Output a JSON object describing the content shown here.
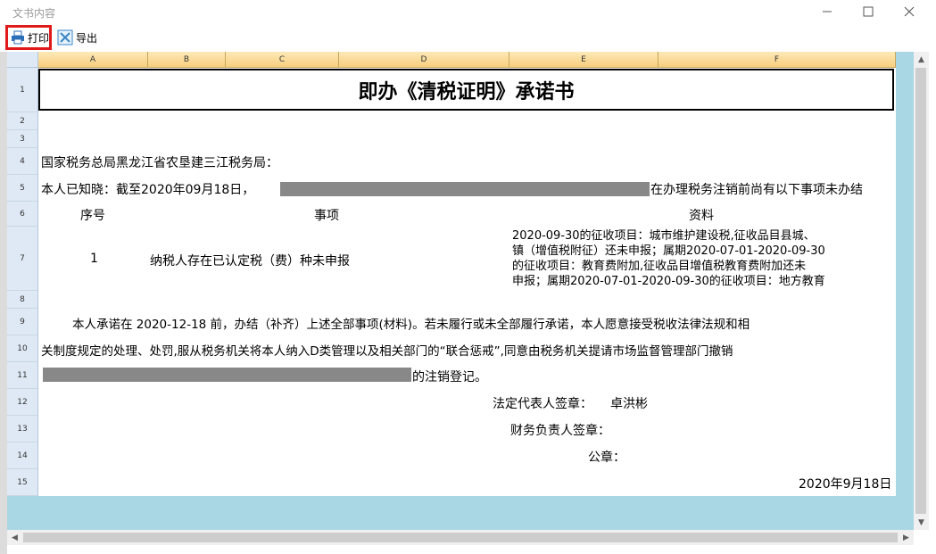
{
  "window": {
    "title": "文书内容",
    "controls": [
      "minimize-icon",
      "maximize-icon",
      "close-icon"
    ]
  },
  "toolbar": {
    "print_label": "打印",
    "export_label": "导出"
  },
  "sheet": {
    "columns": [
      "A",
      "B",
      "C",
      "D",
      "E",
      "F"
    ],
    "rows": [
      "1",
      "2",
      "3",
      "4",
      "5",
      "6",
      "7",
      "8",
      "9",
      "10",
      "11",
      "12",
      "13",
      "14",
      "15"
    ],
    "title": "即办《清税证明》承诺书",
    "addressee": "国家税务总局黑龙江省农垦建三江税务局：",
    "r5_prefix": "本人已知晓：截至2020年09月18日，",
    "r5_suffix": "在办理税务注销前尚有以下事项未办结",
    "col_no": "序号",
    "col_item": "事项",
    "col_info": "资料",
    "item_no": "1",
    "item_name": "纳税人存在已认定税（费）种未申报",
    "info_lines": [
      "2020-09-30的征收项目：城市维护建设税,征收品目县城、",
      "镇（增值税附征）还未申报；属期2020-07-01-2020-09-30",
      "的征收项目：教育费附加,征收品目增值税教育费附加还未",
      "申报；属期2020-07-01-2020-09-30的征收项目：地方教育"
    ],
    "r9": "本人承诺在 2020-12-18 前，办结（补齐）上述全部事项(材料)。若未履行或未全部履行承诺，本人愿意接受税收法律法规和相",
    "r10": "关制度规定的处理、处罚,服从税务机关将本人纳入D类管理以及相关部门的“联合惩戒”,同意由税务机关提请市场监督管理部门撤销",
    "r11_suffix": "的注销登记。",
    "legal_rep": "法定代表人签章：",
    "legal_rep_name": "卓洪彬",
    "finance_head": "财务负责人签章：",
    "seal": "公章：",
    "date": "2020年9月18日"
  },
  "colors": {
    "highlight": "#e01a1a",
    "workspace": "#a9d7e3",
    "column_header": "#f8cf7e"
  }
}
